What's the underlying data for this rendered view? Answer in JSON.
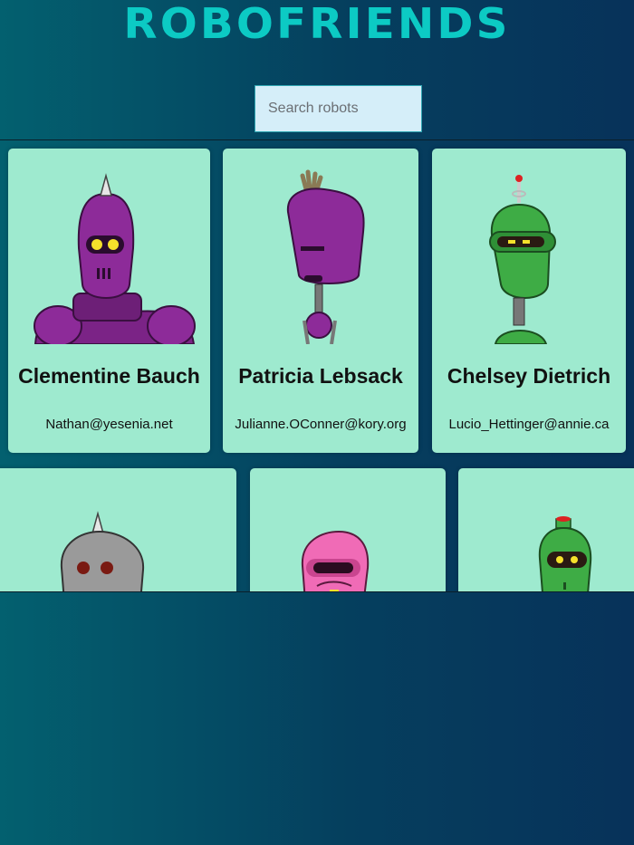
{
  "header": {
    "title": "ROBOFRIENDS"
  },
  "search": {
    "placeholder": "Search robots",
    "value": ""
  },
  "robots": [
    {
      "name": "Clementine Bauch",
      "email": "Nathan@yesenia.net"
    },
    {
      "name": "Patricia Lebsack",
      "email": "Julianne.OConner@kory.org"
    },
    {
      "name": "Chelsey Dietrich",
      "email": "Lucio_Hettinger@annie.ca"
    },
    {
      "name": "",
      "email": ""
    },
    {
      "name": "",
      "email": ""
    },
    {
      "name": "",
      "email": ""
    }
  ],
  "colors": {
    "background_start": "#03606f",
    "background_end": "#07325a",
    "title": "#0ccac4",
    "card": "#9eeacf",
    "search_bg": "#d5eef9"
  }
}
